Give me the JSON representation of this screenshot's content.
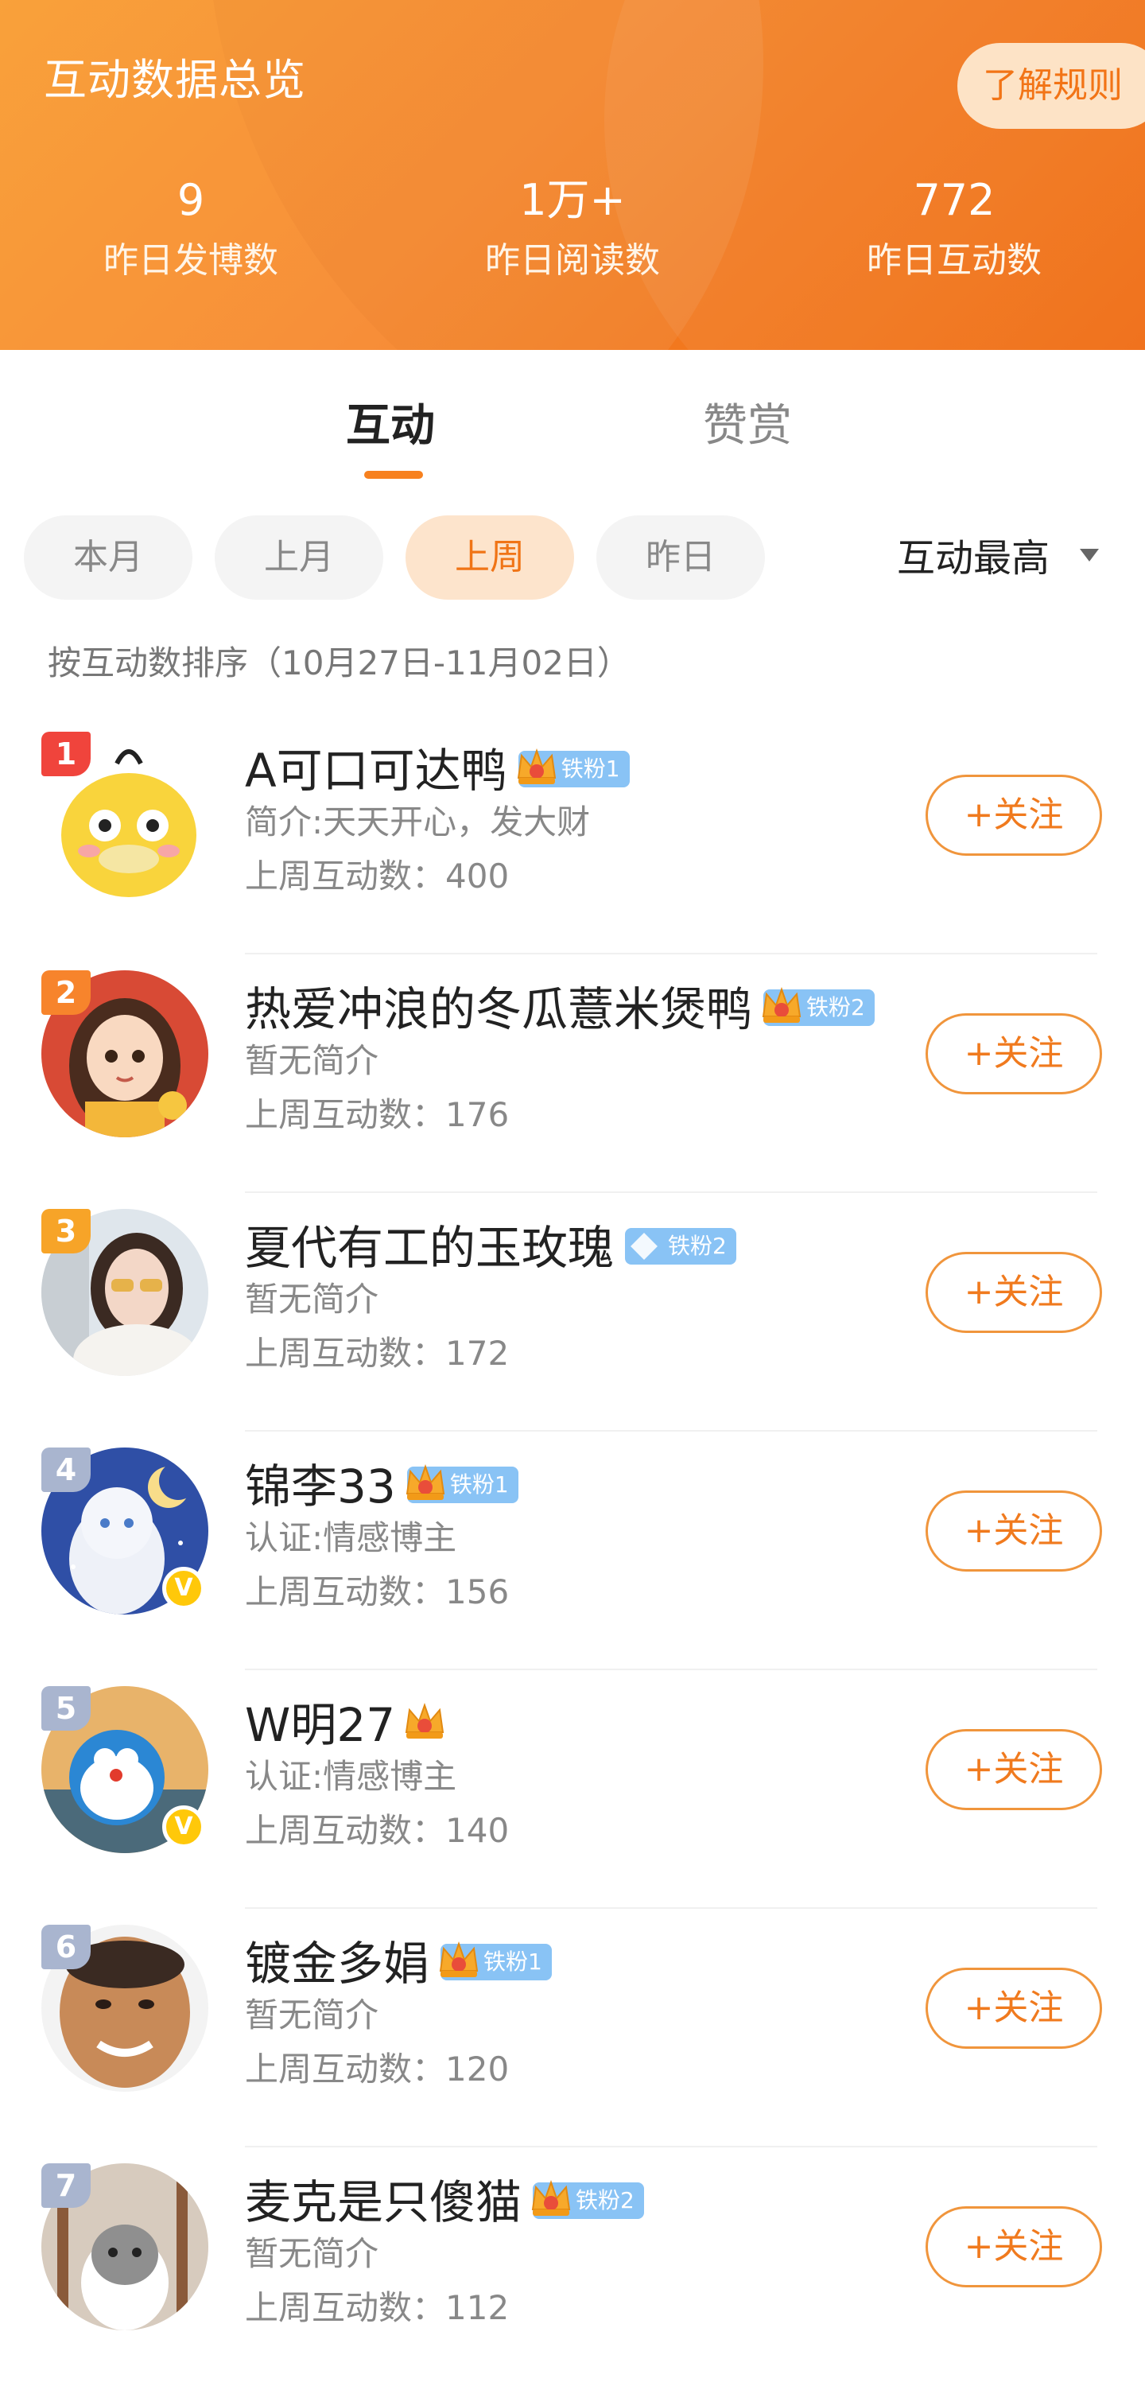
{
  "header": {
    "title": "互动数据总览",
    "rule_button": "了解规则",
    "stats": [
      {
        "value": "9",
        "label": "昨日发博数"
      },
      {
        "value": "1万+",
        "label": "昨日阅读数"
      },
      {
        "value": "772",
        "label": "昨日互动数"
      }
    ]
  },
  "tabs": [
    {
      "label": "互动"
    },
    {
      "label": "赞赏"
    }
  ],
  "filters": [
    "本月",
    "上月",
    "上周",
    "昨日"
  ],
  "selected_filter": "上周",
  "sort_label": "互动最高",
  "subtitle": "按互动数排序（10月27日-11月02日）",
  "follow_label": "+关注",
  "colors": {
    "accent": "#f7811f",
    "header_start": "#f99a2c",
    "header_end": "#f46d12"
  },
  "users": [
    {
      "rank": "1",
      "name": "A可口可达鸭",
      "fan_badge": "铁粉1",
      "bio": "简介:天天开心，发大财",
      "count": "上周互动数：400",
      "rank_color": "#f0443c",
      "verified": false,
      "avatar_desc": "yellow-duck-avatar"
    },
    {
      "rank": "2",
      "name": "热爱冲浪的冬瓜薏米煲鸭",
      "fan_badge": "铁粉2",
      "bio": "暂无简介",
      "count": "上周互动数：176",
      "rank_color": "#f7842c",
      "verified": false,
      "avatar_desc": "cartoon-girl-avatar"
    },
    {
      "rank": "3",
      "name": "夏代有工的玉玫瑰",
      "fan_badge": "铁粉2",
      "bio": "暂无简介",
      "count": "上周互动数：172",
      "rank_color": "#f7a428",
      "verified": false,
      "avatar_desc": "woman-photo-avatar"
    },
    {
      "rank": "4",
      "name": "锦李33",
      "fan_badge": "铁粉1",
      "bio": "认证:情感博主",
      "count": "上周互动数：156",
      "rank_color": "#a9b5cf",
      "verified": true,
      "avatar_desc": "cat-moon-avatar"
    },
    {
      "rank": "5",
      "name": "W明27",
      "fan_badge": "",
      "bio": "认证:情感博主",
      "count": "上周互动数：140",
      "rank_color": "#a9b5cf",
      "verified": true,
      "avatar_desc": "doraemon-avatar"
    },
    {
      "rank": "6",
      "name": "镀金多娟",
      "fan_badge": "铁粉1",
      "bio": "暂无简介",
      "count": "上周互动数：120",
      "rank_color": "#a9b5cf",
      "verified": false,
      "avatar_desc": "man-face-avatar"
    },
    {
      "rank": "7",
      "name": "麦克是只傻猫",
      "fan_badge": "铁粉2",
      "bio": "暂无简介",
      "count": "上周互动数：112",
      "rank_color": "#a9b5cf",
      "verified": false,
      "avatar_desc": "cat-photo-avatar"
    }
  ]
}
